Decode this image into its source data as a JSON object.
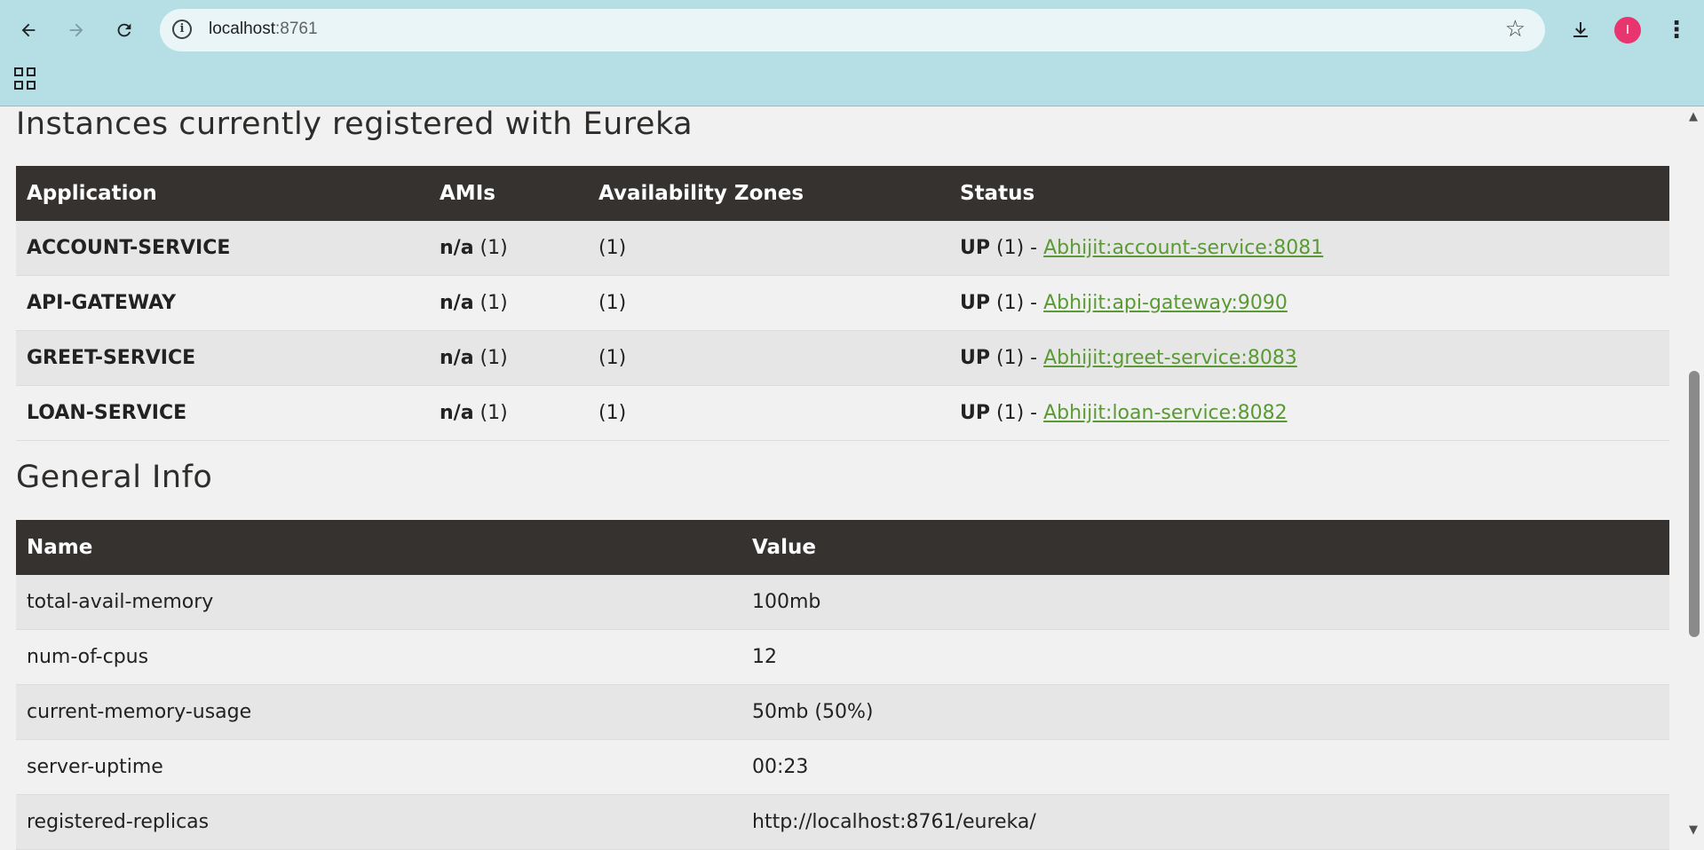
{
  "browser": {
    "url_host": "localhost",
    "url_port": ":8761",
    "back_icon": "arrow-left",
    "forward_icon": "arrow-right",
    "reload_icon": "reload",
    "avatar_initial": "I",
    "accent": "#b6dfe5"
  },
  "instances": {
    "heading": "Instances currently registered with Eureka",
    "columns": [
      "Application",
      "AMIs",
      "Availability Zones",
      "Status"
    ],
    "rows": [
      {
        "app": "ACCOUNT-SERVICE",
        "ami_bold": "n/a",
        "ami_count": "(1)",
        "zones": "(1)",
        "status_bold": "UP",
        "status_rest": "(1) -",
        "link": "Abhijit:account-service:8081"
      },
      {
        "app": "API-GATEWAY",
        "ami_bold": "n/a",
        "ami_count": "(1)",
        "zones": "(1)",
        "status_bold": "UP",
        "status_rest": "(1) -",
        "link": "Abhijit:api-gateway:9090"
      },
      {
        "app": "GREET-SERVICE",
        "ami_bold": "n/a",
        "ami_count": "(1)",
        "zones": "(1)",
        "status_bold": "UP",
        "status_rest": "(1) -",
        "link": "Abhijit:greet-service:8083"
      },
      {
        "app": "LOAN-SERVICE",
        "ami_bold": "n/a",
        "ami_count": "(1)",
        "zones": "(1)",
        "status_bold": "UP",
        "status_rest": "(1) -",
        "link": "Abhijit:loan-service:8082"
      }
    ]
  },
  "general": {
    "heading": "General Info",
    "columns": [
      "Name",
      "Value"
    ],
    "rows": [
      {
        "name": "total-avail-memory",
        "value": "100mb"
      },
      {
        "name": "num-of-cpus",
        "value": "12"
      },
      {
        "name": "current-memory-usage",
        "value": "50mb (50%)"
      },
      {
        "name": "server-uptime",
        "value": "00:23"
      },
      {
        "name": "registered-replicas",
        "value": "http://localhost:8761/eureka/"
      }
    ]
  }
}
